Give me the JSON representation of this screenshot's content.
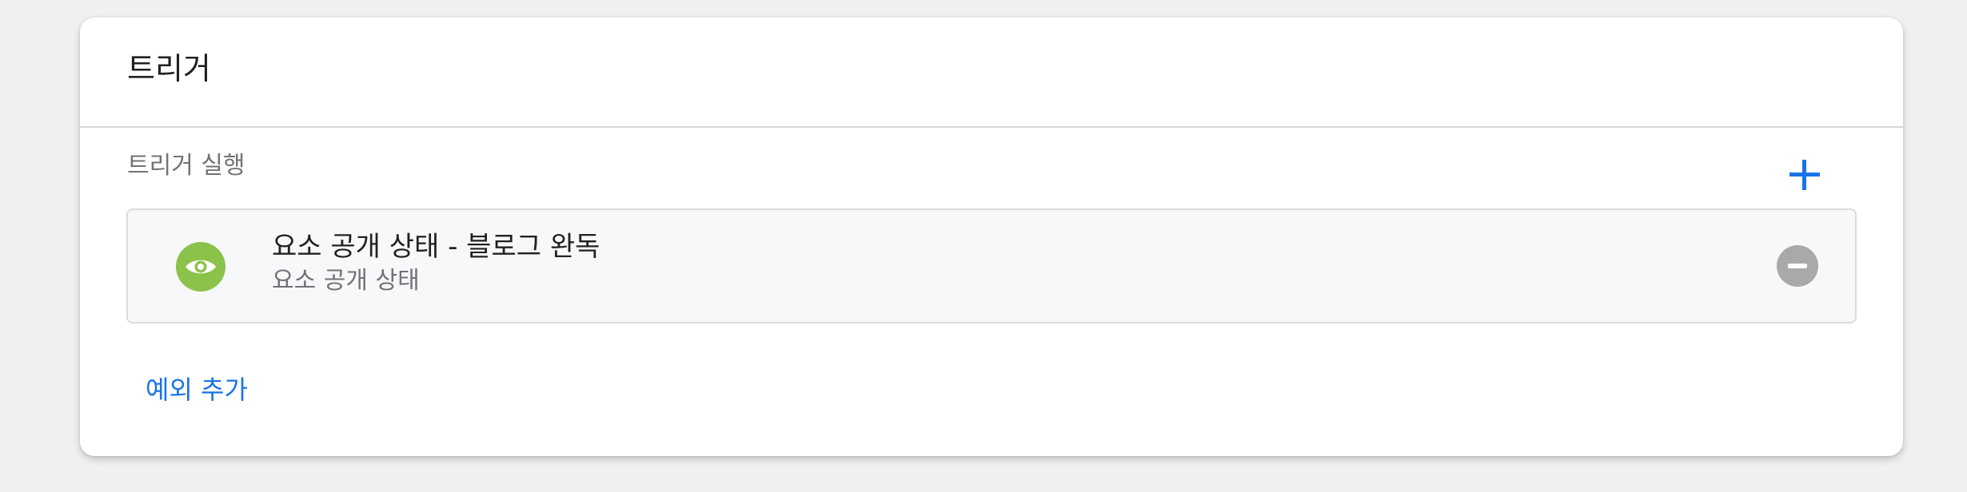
{
  "card": {
    "title": "트리거"
  },
  "firing_triggers": {
    "section_label": "트리거 실행",
    "add_icon": "plus-icon",
    "items": [
      {
        "name": "요소 공개 상태 - 블로그 완독",
        "type": "요소 공개 상태",
        "icon": "eye-icon",
        "icon_color": "#8bc34a",
        "remove_icon": "minus-circle-icon"
      }
    ]
  },
  "exceptions": {
    "add_label": "예외 추가"
  },
  "colors": {
    "accent": "#1a73e8",
    "page_background": "#eef0f2",
    "remove_button": "#a8a9ab"
  }
}
